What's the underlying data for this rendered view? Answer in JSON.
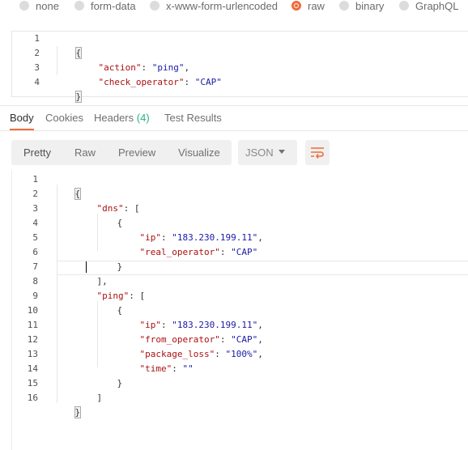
{
  "body_types": [
    {
      "label": "none",
      "selected": false
    },
    {
      "label": "form-data",
      "selected": false
    },
    {
      "label": "x-www-form-urlencoded",
      "selected": false
    },
    {
      "label": "raw",
      "selected": true
    },
    {
      "label": "binary",
      "selected": false
    },
    {
      "label": "GraphQL",
      "selected": false
    }
  ],
  "request_body": {
    "line_numbers": [
      "1",
      "2",
      "3",
      "4"
    ],
    "lines": [
      [
        "{"
      ],
      [
        "\"action\"",
        ": ",
        "\"ping\"",
        ","
      ],
      [
        "\"check_operator\"",
        ": ",
        "\"CAP\""
      ],
      [
        "}"
      ]
    ]
  },
  "response_tabs": {
    "body": "Body",
    "cookies": "Cookies",
    "headers": "Headers",
    "headers_count": "(4)",
    "test_results": "Test Results"
  },
  "format_buttons": {
    "pretty": "Pretty",
    "raw": "Raw",
    "preview": "Preview",
    "visualize": "Visualize"
  },
  "language_select": {
    "value": "JSON"
  },
  "icons": {
    "dropdown": "chevron-down-icon",
    "wrap": "wrap-lines-icon"
  },
  "colors": {
    "accent": "#f26b3a",
    "badge": "#26b47f",
    "json_key": "#aa1111",
    "json_string": "#1a1aa6"
  },
  "response_body": {
    "line_numbers": [
      "1",
      "2",
      "3",
      "4",
      "5",
      "6",
      "7",
      "8",
      "9",
      "10",
      "11",
      "12",
      "13",
      "14",
      "15",
      "16"
    ],
    "lines": [
      [
        "{"
      ],
      [
        "\"dns\"",
        ": ["
      ],
      [
        "{"
      ],
      [
        "\"ip\"",
        ": ",
        "\"183.230.199.11\"",
        ","
      ],
      [
        "\"real_operator\"",
        ": ",
        "\"CAP\""
      ],
      [
        "}"
      ],
      [
        "],"
      ],
      [
        "\"ping\"",
        ": ["
      ],
      [
        "{"
      ],
      [
        "\"ip\"",
        ": ",
        "\"183.230.199.11\"",
        ","
      ],
      [
        "\"from_operator\"",
        ": ",
        "\"CAP\"",
        ","
      ],
      [
        "\"package_loss\"",
        ": ",
        "\"100%\"",
        ","
      ],
      [
        "\"time\"",
        ": ",
        "\"\""
      ],
      [
        "}"
      ],
      [
        "]"
      ],
      [
        "}"
      ]
    ]
  }
}
